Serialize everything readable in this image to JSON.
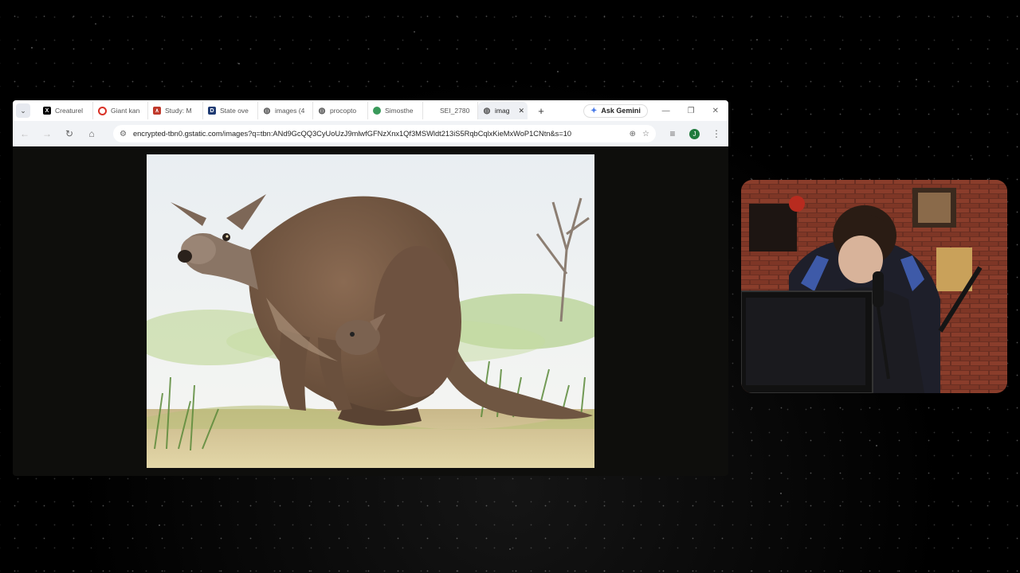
{
  "browser": {
    "tabs": [
      {
        "label": "Creaturel",
        "icon": "x-logo-icon",
        "color": "#000000"
      },
      {
        "label": "Giant kan",
        "icon": "opera-icon",
        "color": "#d93025"
      },
      {
        "label": "Study: M",
        "icon": "study-icon",
        "color": "#c0392b"
      },
      {
        "label": "State ove",
        "icon": "di-icon",
        "color": "#1f3b73"
      },
      {
        "label": "images (4",
        "icon": "globe-icon",
        "color": "#555555"
      },
      {
        "label": "procopto",
        "icon": "globe-icon",
        "color": "#555555"
      },
      {
        "label": "Simosthe",
        "icon": "wikipedia-icon",
        "color": "#3a9a5b"
      },
      {
        "label": "SEI_2780",
        "icon": "doc-icon",
        "color": "#777777"
      },
      {
        "label": "imag",
        "icon": "globe-icon",
        "color": "#555555",
        "active": true
      }
    ],
    "new_tab": "+",
    "gemini_label": "Ask Gemini",
    "url": "encrypted-tbn0.gstatic.com/images?q=tbn:ANd9GcQQ3CyUoUzJ9mlwfGFNzXnx1Qf3MSWldt213iS5RqbCqlxKieMxWoP1CNtn&s=10",
    "profile_initial": "J",
    "accent": "#1e7a3c"
  },
  "content": {
    "image_subject": "illustration of giant prehistoric kangaroo with joey in pouch"
  },
  "webcam": {
    "subject": "streamer at desk with microphone"
  }
}
